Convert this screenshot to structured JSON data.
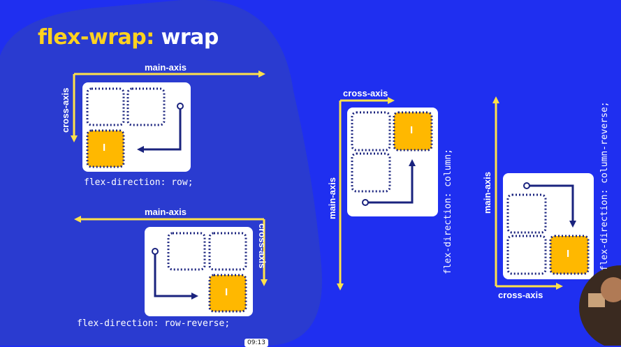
{
  "slide": {
    "title_keyword": "flex-wrap",
    "title_separator": ":",
    "title_value": " wrap",
    "item_marker": "I",
    "timestamp": "09:13"
  },
  "diagrams": [
    {
      "id": "row",
      "main_axis_label": "main-axis",
      "cross_axis_label": "cross-axis",
      "code": "flex-direction: row;"
    },
    {
      "id": "row-reverse",
      "main_axis_label": "main-axis",
      "cross_axis_label": "cross-axis",
      "code": "flex-direction: row-reverse;"
    },
    {
      "id": "column",
      "main_axis_label": "main-axis",
      "cross_axis_label": "cross-axis",
      "code": "flex-direction: column;"
    },
    {
      "id": "column-reverse",
      "main_axis_label": "main-axis",
      "cross_axis_label": "cross-axis",
      "code": "flex-direction: column-reverse;"
    }
  ],
  "colors": {
    "background": "#1f2ff0",
    "blob": "#2a3bd0",
    "axis_yellow": "#ffe14a",
    "item_orange": "#ffb800",
    "dotted_navy": "#1a237e",
    "container_white": "#ffffff"
  }
}
